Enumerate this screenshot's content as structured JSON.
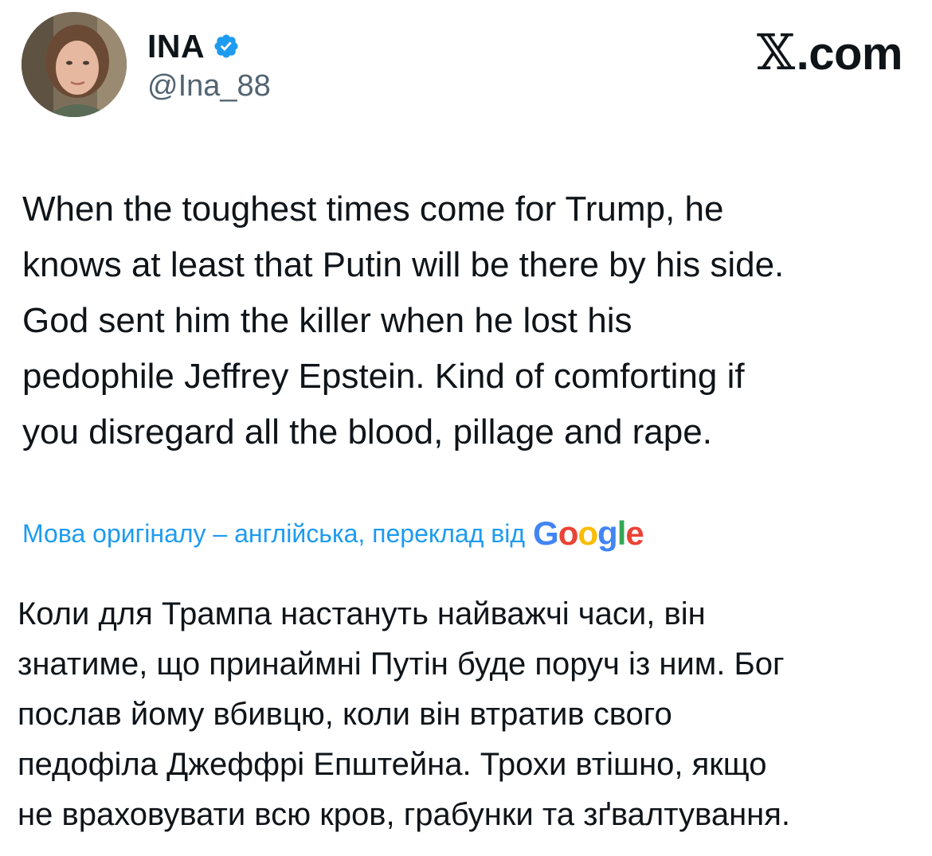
{
  "header": {
    "display_name": "INA",
    "handle": "@Ina_88",
    "site_label": ".com",
    "site_glyph": "𝕏",
    "verified_icon": "verified-badge-icon",
    "avatar": "profile-avatar"
  },
  "tweet": {
    "text": "When the toughest times come for Trump, he\nknows at least that Putin will be there by his side.\nGod sent him the killer when he lost his\npedophile Jeffrey Epstein. Kind of comforting if\nyou disregard all the blood, pillage and rape."
  },
  "translation": {
    "notice": "Мова оригіналу – англійська, переклад від",
    "provider_letters": [
      "G",
      "o",
      "o",
      "g",
      "l",
      "e"
    ],
    "text": "Коли для Трампа настануть найважчі часи, він\nзнатиме, що принаймні Путін буде поруч із ним. Бог\nпослав йому вбивцю, коли він втратив свого\nпедофіла Джеффрі Епштейна. Трохи втішно, якщо\nне враховувати всю кров, грабунки та зґвалтування."
  },
  "colors": {
    "link_blue": "#1d9bf0",
    "text_dark": "#0f1419",
    "handle_gray": "#536471",
    "google_blue": "#4285f4",
    "google_red": "#ea4335",
    "google_yellow": "#fbbc05",
    "google_green": "#34a853"
  }
}
